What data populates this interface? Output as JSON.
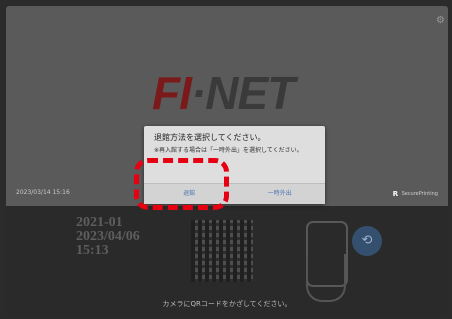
{
  "logo": {
    "left": "FI",
    "sep": "·",
    "right": "NET"
  },
  "status": {
    "datetime": "2023/03/14 15:16",
    "brand_name": "SecurePrinting",
    "brand_mark": "ʀ"
  },
  "ticket": {
    "lines": [
      "2021-01",
      "2023/04/06",
      "15:13"
    ]
  },
  "footer": {
    "instruction": "カメラにQRコードをかざしてください。"
  },
  "dialog": {
    "title": "退館方法を選択してください。",
    "note": "※再入館する場合は「一時外出」を選択してください。",
    "buttons": {
      "exit": "退館",
      "temp": "一時外出"
    }
  },
  "icons": {
    "settings": "gear-icon",
    "scan": "scan-icon"
  },
  "colors": {
    "highlight": "#e60012",
    "logo_red": "#7a1a1a",
    "link": "#4c78b0"
  }
}
